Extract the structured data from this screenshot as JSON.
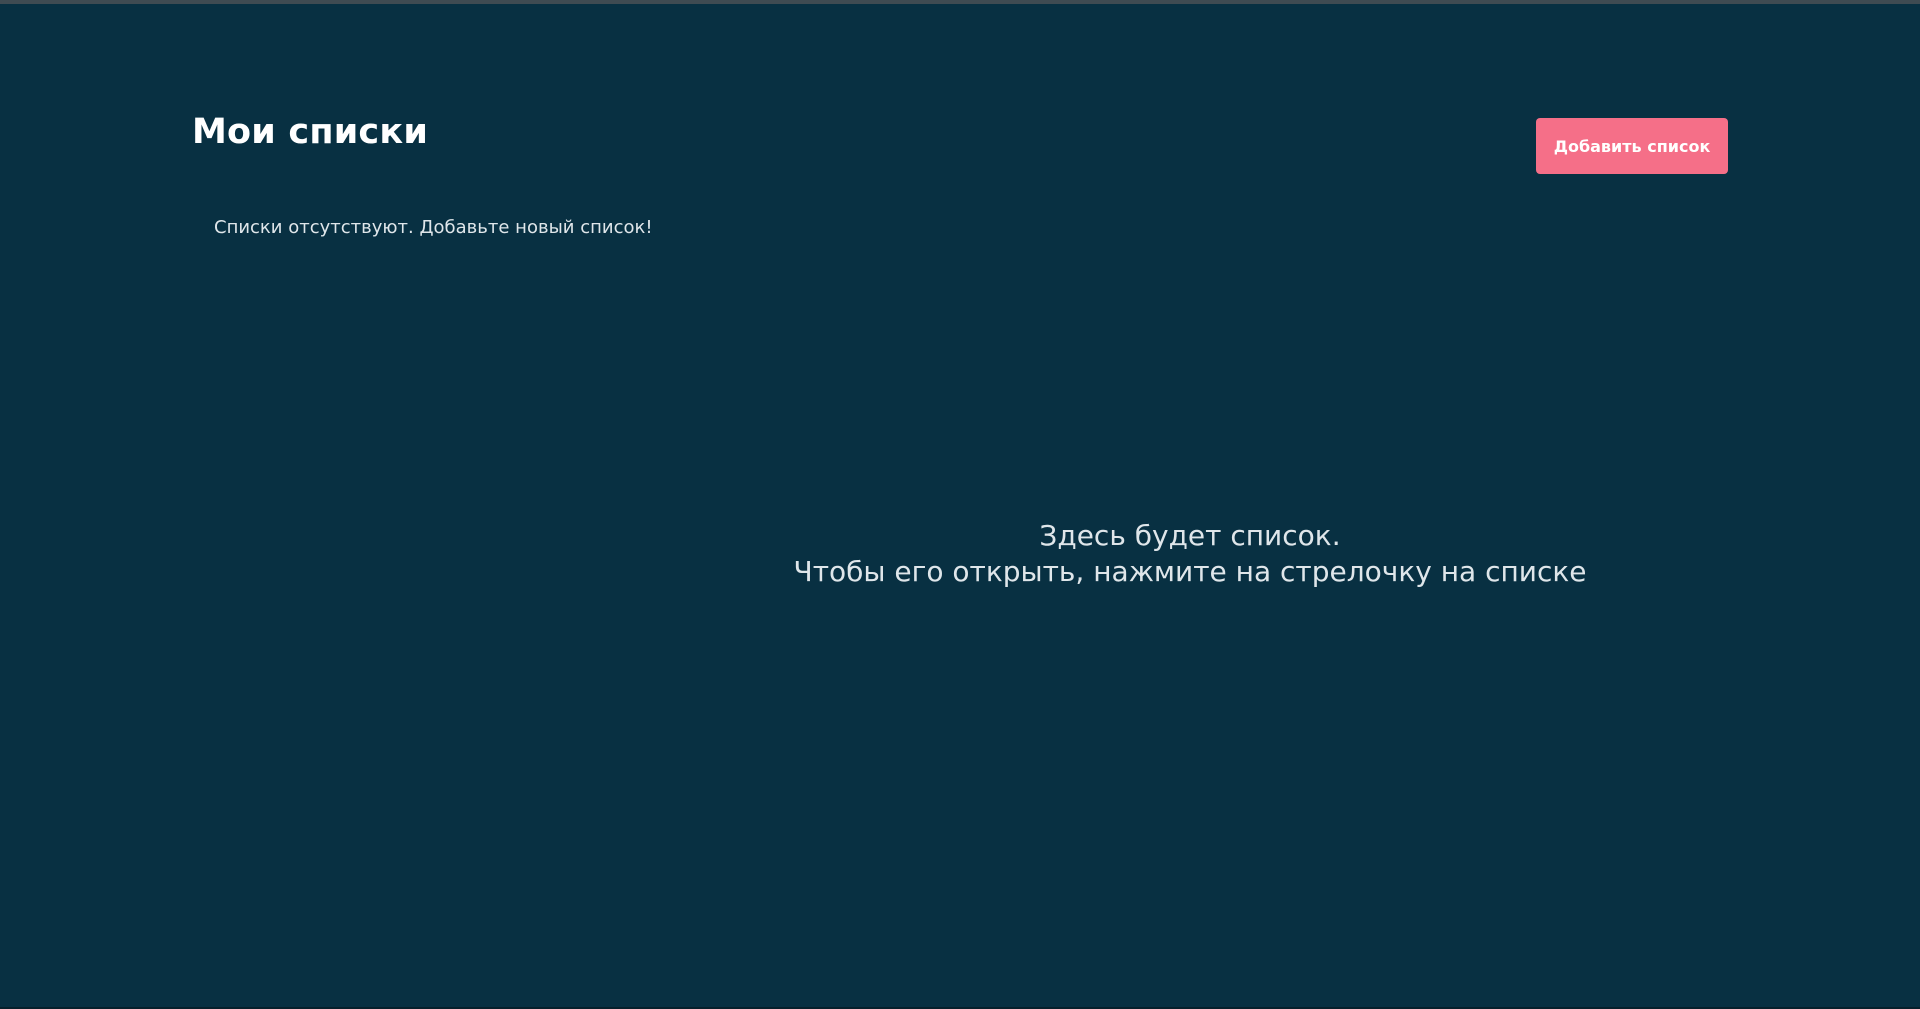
{
  "header": {
    "title": "Мои списки",
    "add_button_label": "Добавить список"
  },
  "sidebar": {
    "empty_message": "Списки отсутствуют. Добавьте новый список!"
  },
  "main": {
    "placeholder_line1": "Здесь будет список.",
    "placeholder_line2": "Чтобы его открыть, нажмите на стрелочку на списке"
  },
  "colors": {
    "background": "#083042",
    "accent": "#f56f88",
    "text": "#dfe6ea"
  }
}
